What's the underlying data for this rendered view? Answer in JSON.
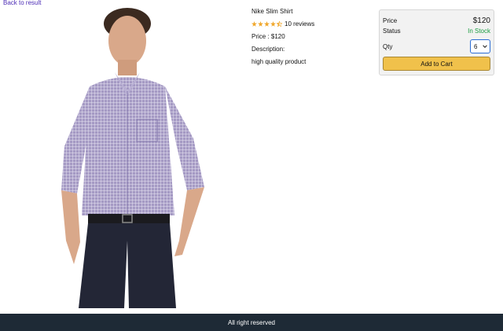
{
  "nav": {
    "back_label": "Back to result"
  },
  "product": {
    "name": "Nike Slim Shirt",
    "rating": 4.5,
    "reviews_text": "10 reviews",
    "price_text": "Price : $120",
    "description_label": "Description:",
    "description": "high quality product",
    "image_icon": "product-photo-man-in-checked-shirt"
  },
  "purchase": {
    "price_label": "Price",
    "price_value": "$120",
    "status_label": "Status",
    "status_value": "In Stock",
    "qty_label": "Qty",
    "qty_value": "6",
    "add_label": "Add to Cart"
  },
  "footer": {
    "text": "All right reserved"
  },
  "colors": {
    "star": "#f0a82e",
    "in_stock": "#1a9c41",
    "button": "#f0c14b",
    "footer_bg": "#1e2a36",
    "link": "#4b2bb5"
  }
}
